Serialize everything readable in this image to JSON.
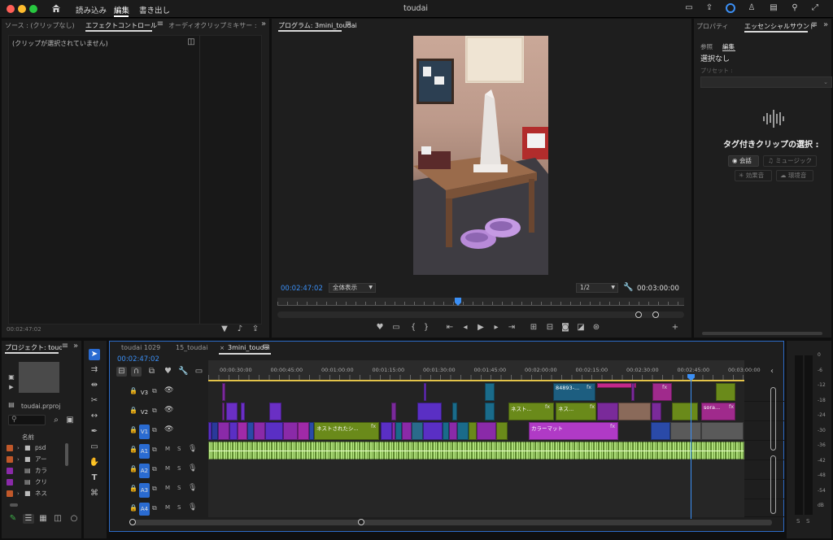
{
  "window": {
    "title": "toudai"
  },
  "menu": {
    "import": "読み込み",
    "edit": "編集",
    "export": "書き出し"
  },
  "source_panel": {
    "tab_source": "ソース : (クリップなし)",
    "tab_effects": "エフェクトコントロール",
    "tab_mixer": "オーディオクリップミキサー : 3mini",
    "no_clip": "(クリップが選択されていません)",
    "timecode": "00:02:47:02"
  },
  "program": {
    "tab": "プログラム: 3mini_toudai",
    "timecode": "00:02:47:02",
    "fit": "全体表示",
    "resolution": "1/2",
    "duration": "00:03:00:00"
  },
  "right_panel": {
    "tab_properties": "プロパティ",
    "tab_essential": "エッセンシャルサウンド",
    "sub_browse": "参照",
    "sub_edit": "編集",
    "no_selection": "選択なし",
    "preset_label": "プリセット :",
    "heading": "タグ付きクリップの選択 :",
    "btn_dialogue": "会話",
    "btn_music": "ミュージック",
    "btn_sfx": "効果音",
    "btn_ambience": "環境音"
  },
  "project": {
    "tab": "プロジェクト: toudai",
    "file": "toudai.prproj",
    "col_name": "名前",
    "items": [
      {
        "name": "psd",
        "color": "#c0582a"
      },
      {
        "name": "アー",
        "color": "#c0582a"
      },
      {
        "name": "カラ",
        "color": "#8a2aa8"
      },
      {
        "name": "クリ",
        "color": "#8a2aa8"
      },
      {
        "name": "ネス",
        "color": "#c0582a"
      }
    ]
  },
  "timeline": {
    "tabs": [
      "toudai 1029",
      "15_toudai",
      "3mini_toudai"
    ],
    "timecode": "00:02:47:02",
    "ruler": [
      "00:00:30:00",
      "00:00:45:00",
      "00:01:00:00",
      "00:01:15:00",
      "00:01:30:00",
      "00:01:45:00",
      "00:02:00:00",
      "00:02:15:00",
      "00:02:30:00",
      "00:02:45:00",
      "00:03:00:00"
    ],
    "tracks": [
      "V3",
      "V2",
      "V1",
      "A1",
      "A2",
      "A3",
      "A4"
    ],
    "clip_labels": {
      "v3_title": "84893-...",
      "v2_a": "ネスト...",
      "v2_b": "ネス...",
      "v2_c": "sora...",
      "v1_nest": "ネストされたシ...",
      "v1_color": "カラーマット",
      "fx": "fx"
    },
    "mute": "M",
    "solo": "S"
  },
  "meter": {
    "scale": [
      "0",
      "-6",
      "-12",
      "-18",
      "-24",
      "-30",
      "-36",
      "-42",
      "-48",
      "-54",
      "dB"
    ],
    "solo_l": "S",
    "solo_r": "S"
  }
}
